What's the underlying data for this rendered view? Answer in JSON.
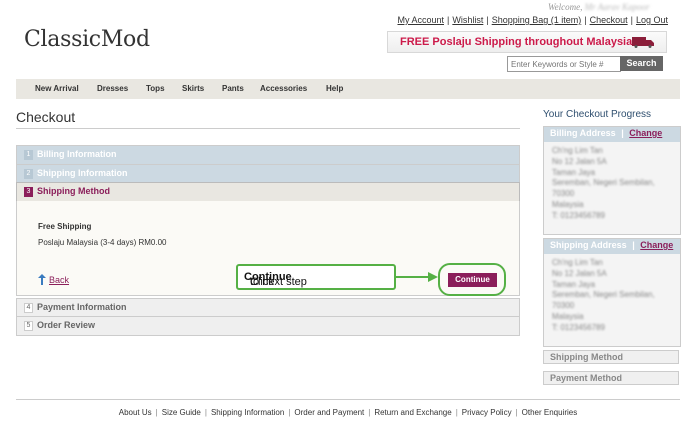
{
  "header": {
    "welcome_prefix": "Welcome,",
    "welcome_name": "Mr Aarav Kapoor",
    "links": [
      "My Account",
      "Wishlist",
      "Shopping Bag (1 item)",
      "Checkout",
      "Log Out"
    ],
    "logo": "ClassicMod",
    "banner_text": "FREE Poslaju Shipping throughout Malaysia",
    "search_placeholder": "Enter Keywords or Style #",
    "search_button": "Search"
  },
  "nav": [
    "New Arrival",
    "Dresses",
    "Tops",
    "Skirts",
    "Pants",
    "Accessories",
    "Help"
  ],
  "checkout": {
    "title": "Checkout",
    "steps": [
      {
        "num": "1",
        "label": "Billing Information"
      },
      {
        "num": "2",
        "label": "Shipping Information"
      },
      {
        "num": "3",
        "label": "Shipping Method"
      },
      {
        "num": "4",
        "label": "Payment Information"
      },
      {
        "num": "5",
        "label": "Order Review"
      }
    ],
    "shipping_title": "Free Shipping",
    "shipping_option": "Poslaju Malaysia (3-4 days) RM0.00",
    "back_label": "Back",
    "continue_label": "Continue",
    "callout_prefix": "Click ",
    "callout_bold": "Continue",
    "callout_suffix": " to next step"
  },
  "progress": {
    "title": "Your Checkout Progress",
    "billing": {
      "title": "Billing Address",
      "change": "Change",
      "lines": [
        "Ch'ng Lim Tan",
        "No 12 Jalan 5A",
        "Taman Jaya",
        "Seremban, Negeri Sembilan,",
        "70300",
        "Malaysia",
        "T: 0123456789"
      ]
    },
    "shipping": {
      "title": "Shipping Address",
      "change": "Change",
      "lines": [
        "Ch'ng Lim Tan",
        "No 12 Jalan 5A",
        "Taman Jaya",
        "Seremban, Negeri Sembilan,",
        "70300",
        "Malaysia",
        "T: 0123456789"
      ]
    },
    "method": "Shipping Method",
    "payment": "Payment Method"
  },
  "footer": [
    "About Us",
    "Size Guide",
    "Shipping Information",
    "Order and Payment",
    "Return and Exchange",
    "Privacy Policy",
    "Other Enquiries"
  ],
  "colors": {
    "accent": "#8b1e5a",
    "highlight": "#55b045",
    "banner_text": "#cc1a4a",
    "step_done": "#ccd9e2"
  }
}
